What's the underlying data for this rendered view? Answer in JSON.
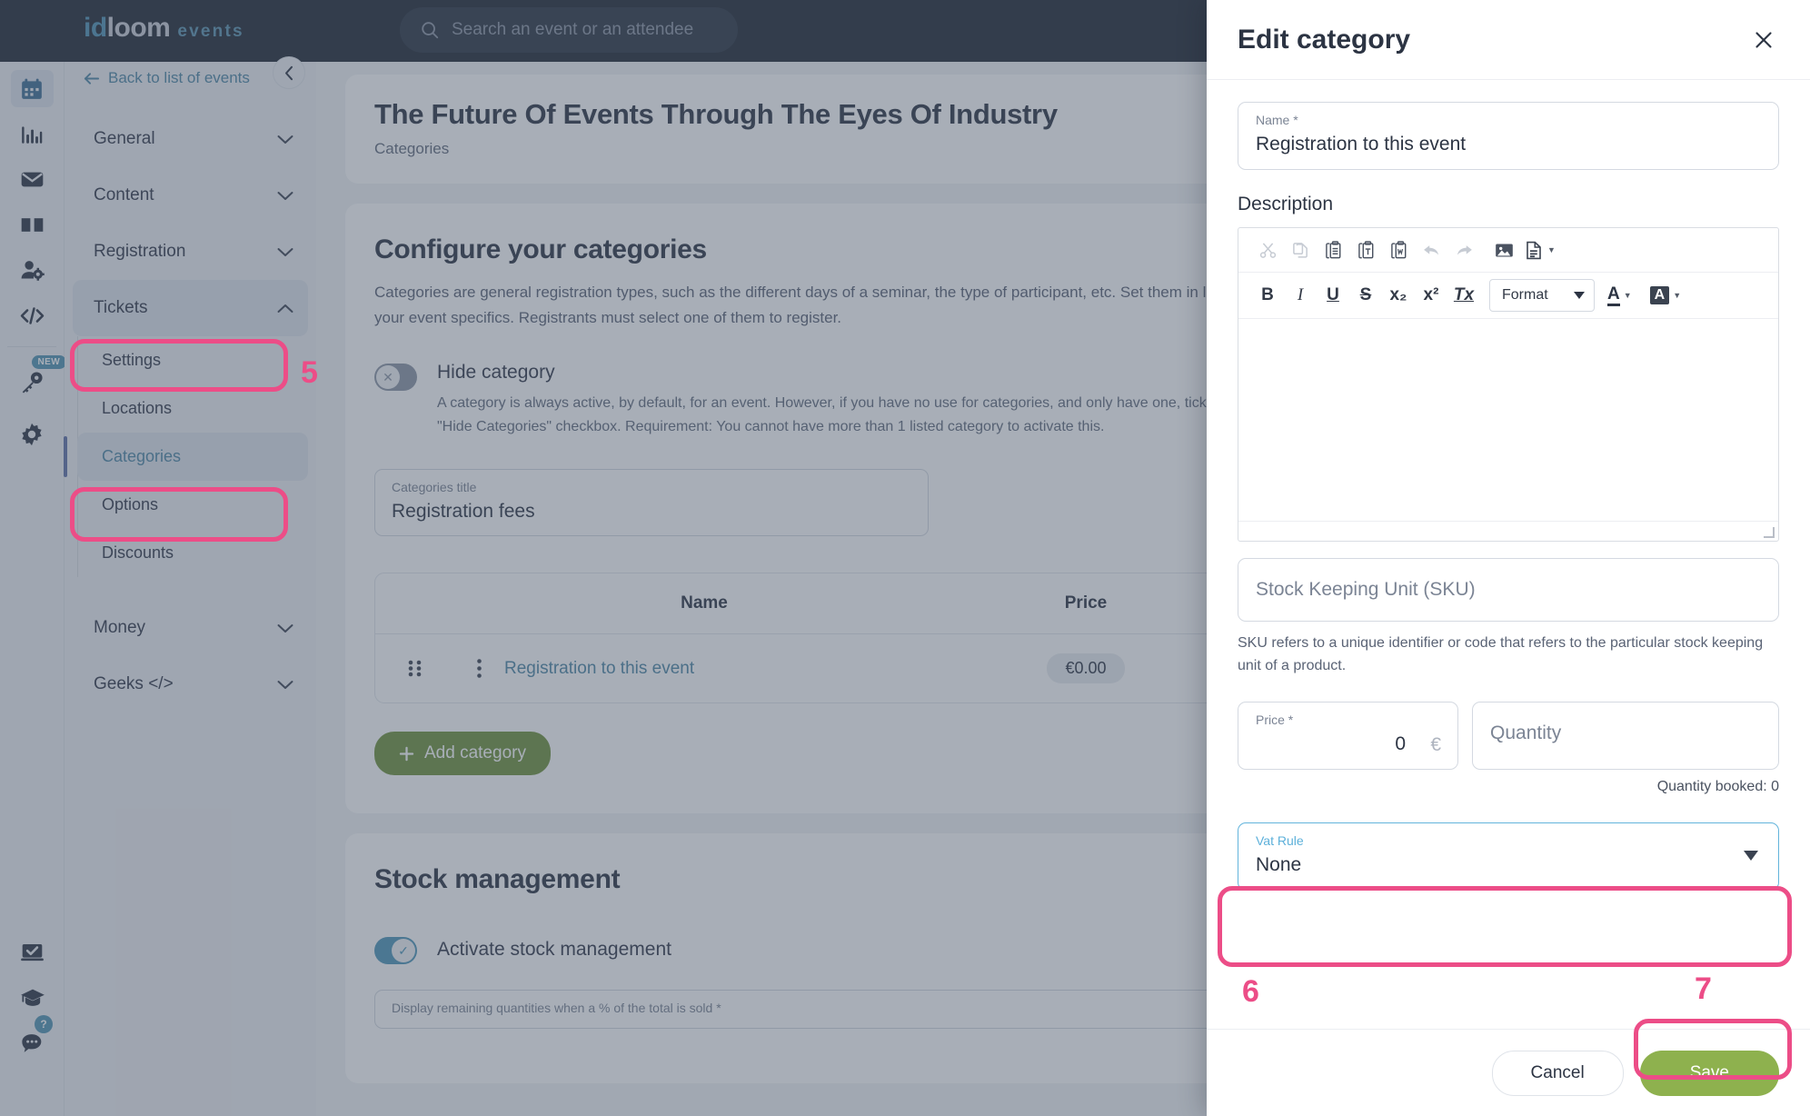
{
  "brand": {
    "logo_id": "id",
    "logo_loom": "loom",
    "logo_events": "events",
    "accent_pink": "#ec4d87",
    "accent_blue": "#4d87a5",
    "accent_green": "#8eb14e",
    "dark_header": "#1f2733"
  },
  "topbar": {
    "search_placeholder": "Search an event or an attendee"
  },
  "rail": {
    "items": [
      {
        "name": "calendar-icon",
        "label": "Events"
      },
      {
        "name": "chart-icon",
        "label": "Statistics"
      },
      {
        "name": "mail-icon",
        "label": "Emails"
      },
      {
        "name": "book-icon",
        "label": "Library"
      },
      {
        "name": "user-settings-icon",
        "label": "Attendees"
      },
      {
        "name": "code-icon",
        "label": "Developers"
      },
      {
        "name": "key-icon",
        "label": "Access",
        "badge": "NEW"
      },
      {
        "name": "gear-icon",
        "label": "Settings"
      }
    ],
    "bottom_items": [
      {
        "name": "inbox-check-icon",
        "label": "Tasks"
      },
      {
        "name": "graduation-cap-icon",
        "label": "Academy"
      },
      {
        "name": "chat-icon",
        "label": "Support",
        "badge": "?"
      }
    ]
  },
  "nav": {
    "back_label": "Back to list of events",
    "collapse_icon": "chevron-left-icon",
    "groups": [
      {
        "label": "General",
        "expanded": false
      },
      {
        "label": "Content",
        "expanded": false
      },
      {
        "label": "Registration",
        "expanded": false
      },
      {
        "label": "Tickets",
        "expanded": true,
        "items": [
          {
            "label": "Settings",
            "selected": false
          },
          {
            "label": "Locations",
            "selected": false
          },
          {
            "label": "Categories",
            "selected": true
          },
          {
            "label": "Options",
            "selected": false
          },
          {
            "label": "Discounts",
            "selected": false
          }
        ]
      },
      {
        "label": "Money",
        "expanded": false
      },
      {
        "label": "Geeks </>",
        "expanded": false
      }
    ]
  },
  "main": {
    "event_title": "The Future Of Events Through The Eyes Of Industry",
    "breadcrumb": "Categories",
    "section_title": "Configure your categories",
    "section_desc": "Categories are general registration types, such as the different days of a seminar, the type of participant, etc. Set them in line with your event specifics. Registrants must select one of them to register.",
    "hide_toggle": {
      "label": "Hide category",
      "state": "off",
      "desc": "A category is always active, by default, for an event. However, if you have no use for categories, and only have one, tick on the \"Hide Categories\" checkbox. Requirement: You cannot have more than 1 listed category to activate this."
    },
    "categories_title_field": {
      "label": "Categories title",
      "value": "Registration fees"
    },
    "table": {
      "columns": [
        "Name",
        "Price"
      ],
      "rows": [
        {
          "grip_icon": "drag-grip-icon",
          "menu_icon": "kebab-menu-icon",
          "name": "Registration to this event",
          "price": "€0.00"
        }
      ]
    },
    "add_button": "Add category",
    "add_button_icon": "plus-icon",
    "stock": {
      "title": "Stock management",
      "toggle_label": "Activate stock management",
      "toggle_state": "on",
      "field_label": "Display remaining quantities when a % of the total is sold *"
    }
  },
  "drawer": {
    "title": "Edit category",
    "close_icon": "close-icon",
    "name_field": {
      "label": "Name *",
      "value": "Registration to this event"
    },
    "description_label": "Description",
    "editor": {
      "toolbar_row1": [
        {
          "name": "cut-icon",
          "label": "Cut",
          "disabled": true
        },
        {
          "name": "copy-icon",
          "label": "Copy",
          "disabled": true
        },
        {
          "name": "paste-icon",
          "label": "Paste",
          "disabled": false
        },
        {
          "name": "paste-text-icon",
          "label": "Paste as plain text",
          "disabled": false
        },
        {
          "name": "paste-word-icon",
          "label": "Paste from Word",
          "disabled": false
        },
        {
          "name": "undo-icon",
          "label": "Undo",
          "disabled": true
        },
        {
          "name": "redo-icon",
          "label": "Redo",
          "disabled": true
        },
        {
          "name": "image-icon",
          "label": "Image",
          "disabled": false
        },
        {
          "name": "templates-icon",
          "label": "Templates",
          "disabled": false
        }
      ],
      "toolbar_row2": [
        {
          "name": "bold-icon",
          "label": "B"
        },
        {
          "name": "italic-icon",
          "label": "I"
        },
        {
          "name": "underline-icon",
          "label": "U"
        },
        {
          "name": "strikethrough-icon",
          "label": "S"
        },
        {
          "name": "subscript-icon",
          "label": "x₂"
        },
        {
          "name": "superscript-icon",
          "label": "x²"
        },
        {
          "name": "remove-format-icon",
          "label": "Tx"
        }
      ],
      "format_select": "Format",
      "text_color_icon": "text-color-icon",
      "bg_color_icon": "background-color-icon",
      "content": ""
    },
    "sku_field": {
      "placeholder": "Stock Keeping Unit (SKU)",
      "value": ""
    },
    "sku_help": "SKU refers to a unique identifier or code that refers to the particular stock keeping unit of a product.",
    "price_field": {
      "label": "Price *",
      "value": "0",
      "currency": "€"
    },
    "quantity_field": {
      "placeholder": "Quantity",
      "value": ""
    },
    "quantity_booked": "Quantity booked: 0",
    "vat_field": {
      "label": "Vat Rule",
      "value": "None",
      "caret_icon": "chevron-down-icon"
    },
    "cancel_label": "Cancel",
    "save_label": "Save"
  },
  "annotations": [
    {
      "number": "5",
      "target": "tickets-nav-group"
    },
    {
      "number": "6",
      "target": "vat-rule-select"
    },
    {
      "number": "7",
      "target": "save-button"
    }
  ]
}
